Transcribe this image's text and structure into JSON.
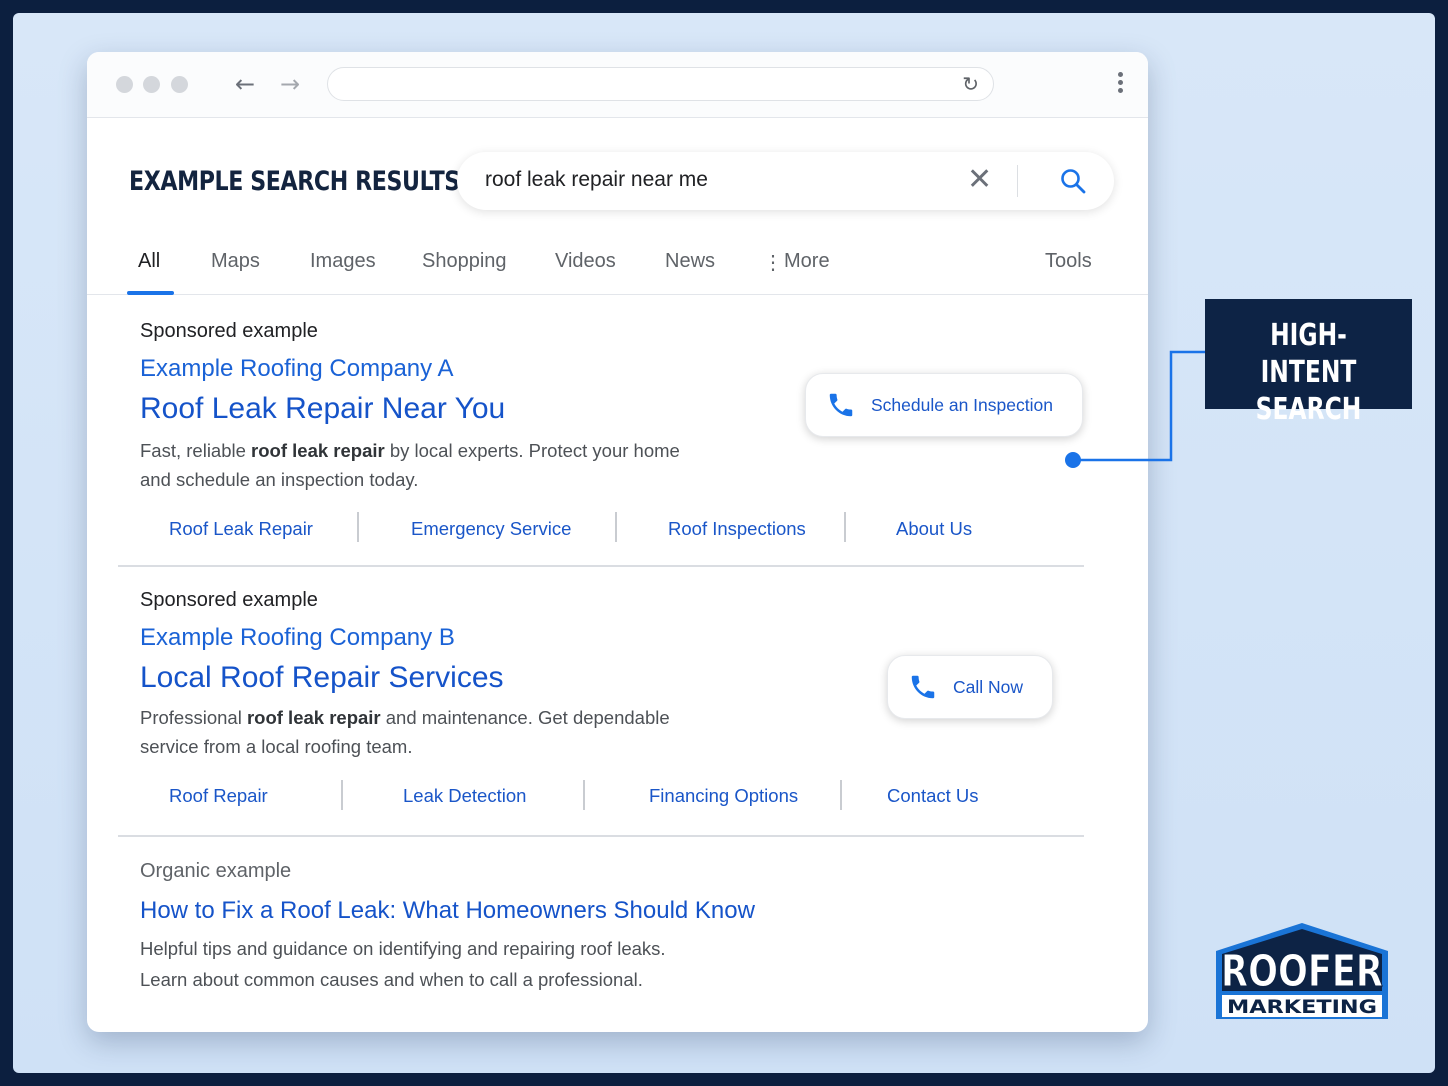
{
  "browser": {
    "url": "",
    "back_icon": "arrow-left-icon",
    "forward_icon": "arrow-right-icon"
  },
  "page": {
    "title": "EXAMPLE SEARCH RESULTS"
  },
  "search": {
    "query": "roof leak repair near me"
  },
  "tabs": [
    {
      "label": "All",
      "active": true
    },
    {
      "label": "Maps"
    },
    {
      "label": "Images"
    },
    {
      "label": "Shopping"
    },
    {
      "label": "Videos"
    },
    {
      "label": "News"
    },
    {
      "label": "More"
    },
    {
      "label": "Tools"
    }
  ],
  "results": [
    {
      "label": "Sponsored example",
      "company": "Example Roofing Company A",
      "headline": "Roof Leak Repair Near You",
      "desc_line1_a": "Fast, reliable ",
      "desc_line1_b": "roof leak repair",
      "desc_line1_c": " by local experts. Protect your home",
      "desc_line2": "and schedule an inspection today.",
      "sitelinks": [
        "Roof Leak Repair",
        "Emergency Service",
        "Roof Inspections",
        "About Us"
      ],
      "cta": "Schedule an Inspection"
    },
    {
      "label": "Sponsored example",
      "company": "Example Roofing Company B",
      "headline": "Local Roof Repair Services",
      "desc_line1_a": "Professional ",
      "desc_line1_b": "roof leak repair",
      "desc_line1_c": " and maintenance. Get dependable",
      "desc_line2": "service from a local roofing team.",
      "sitelinks": [
        "Roof Repair",
        "Leak Detection",
        "Financing Options",
        "Contact Us"
      ],
      "cta": "Call Now"
    },
    {
      "label": "Organic example",
      "headline": "How to Fix a Roof Leak: What Homeowners Should Know",
      "desc_line1": "Helpful tips and guidance on identifying and repairing roof leaks.",
      "desc_line2": "Learn about common causes and when to call a professional."
    }
  ],
  "callout": {
    "line1": "HIGH-INTENT",
    "line2": "SEARCH"
  },
  "logo": {
    "line1": "ROOFER",
    "line2": "MARKETING"
  },
  "colors": {
    "frame": "#0c1f3f",
    "background": "#d8e7f8",
    "link_blue": "#1a56c8",
    "accent_blue": "#1a73e8",
    "callout_bg": "#0d2345"
  }
}
